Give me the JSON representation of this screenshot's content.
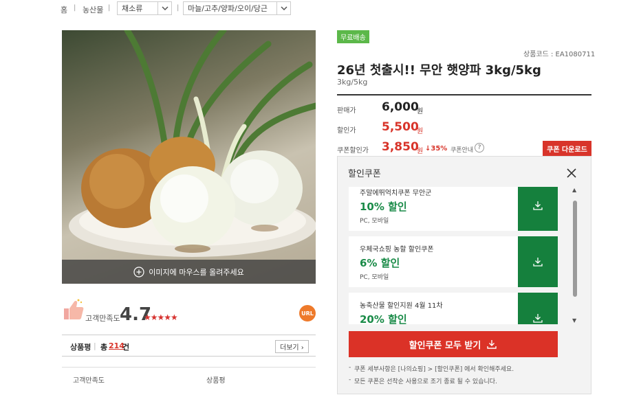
{
  "breadcrumb": {
    "home": "홈",
    "level1": "농산물",
    "level2": "채소류",
    "level3": "마늘/고추/양파/오이/당근"
  },
  "image": {
    "hover_hint": "이미지에 마우스를 올려주세요"
  },
  "rating": {
    "label": "고객만족도",
    "score": "4.7",
    "stars": "★★★★★",
    "url_badge": "URL"
  },
  "reviews": {
    "label": "상품평",
    "total_prefix": "총",
    "count": "214",
    "suffix": "건",
    "more": "더보기"
  },
  "table_header": {
    "col1": "고객만족도",
    "col2": "상품평"
  },
  "product": {
    "badge": "무료배송",
    "code": "상품코드 : EA1080711",
    "title": "26년 첫출시!! 무안 햇양파 3kg/5kg",
    "subtitle": "3kg/5kg"
  },
  "prices": {
    "sale_label": "판매가",
    "sale_value": "6,000",
    "discount_label": "할인가",
    "discount_value": "5,500",
    "coupon_label": "쿠폰할인가",
    "coupon_value": "3,850",
    "won": "원",
    "rate": "↓35%",
    "coupon_info": "쿠폰안내",
    "coupon_download": "쿠폰 다운로드"
  },
  "coupon_popup": {
    "title": "할인쿠폰",
    "coupons": [
      {
        "name": "주말에뛰억치쿠폰 무안군",
        "percent": "10% 할인",
        "platform": "PC, 모바일"
      },
      {
        "name": "우체국쇼핑 농할 할인쿠폰",
        "percent": "6% 할인",
        "platform": "PC, 모바일"
      },
      {
        "name": "농축산물 할인지원 4월 11차",
        "percent": "20% 할인",
        "platform": ""
      }
    ],
    "download_all": "할인쿠폰 모두 받기",
    "notes": [
      "쿠폰 세부사항은 [나의쇼핑] > [할인쿠폰] 에서 확인해주세요.",
      "모든 쿠폰은 선착순 사용으로 조기 종료 될 수 있습니다."
    ]
  },
  "colors": {
    "accent_red": "#db3227",
    "coupon_green": "#15803d",
    "badge_green": "#5cb84a",
    "url_orange": "#ee7a2b"
  }
}
